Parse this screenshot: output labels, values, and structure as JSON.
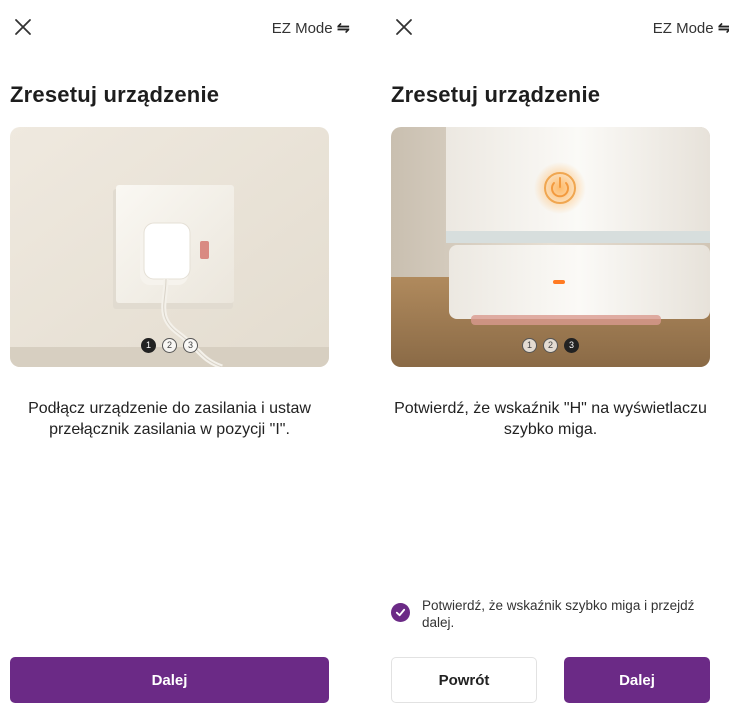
{
  "colors": {
    "accent": "#6b2a86"
  },
  "screens": [
    {
      "close_icon": "close-icon",
      "mode_label": "EZ Mode",
      "swap_icon": "⇋",
      "title": "Zresetuj urządzenie",
      "image": "wall-socket-plug-photo",
      "step_indicator": {
        "steps": [
          "1",
          "2",
          "3"
        ],
        "active": 1
      },
      "description": "Podłącz urządzenie do zasilania i ustaw przełącznik zasilania w pozycji \"I\".",
      "primary_button": "Dalej"
    },
    {
      "close_icon": "close-icon",
      "mode_label": "EZ Mode",
      "swap_icon": "⇋",
      "title": "Zresetuj urządzenie",
      "image": "device-power-indicator-photo",
      "step_indicator": {
        "steps": [
          "1",
          "2",
          "3"
        ],
        "active": 3
      },
      "description": "Potwierdź, że wskaźnik \"H\" na wyświetlaczu szybko miga.",
      "confirm": {
        "checked": true,
        "label": "Potwierdź, że wskaźnik szybko miga i przejdź dalej."
      },
      "secondary_button": "Powrót",
      "primary_button": "Dalej"
    }
  ]
}
